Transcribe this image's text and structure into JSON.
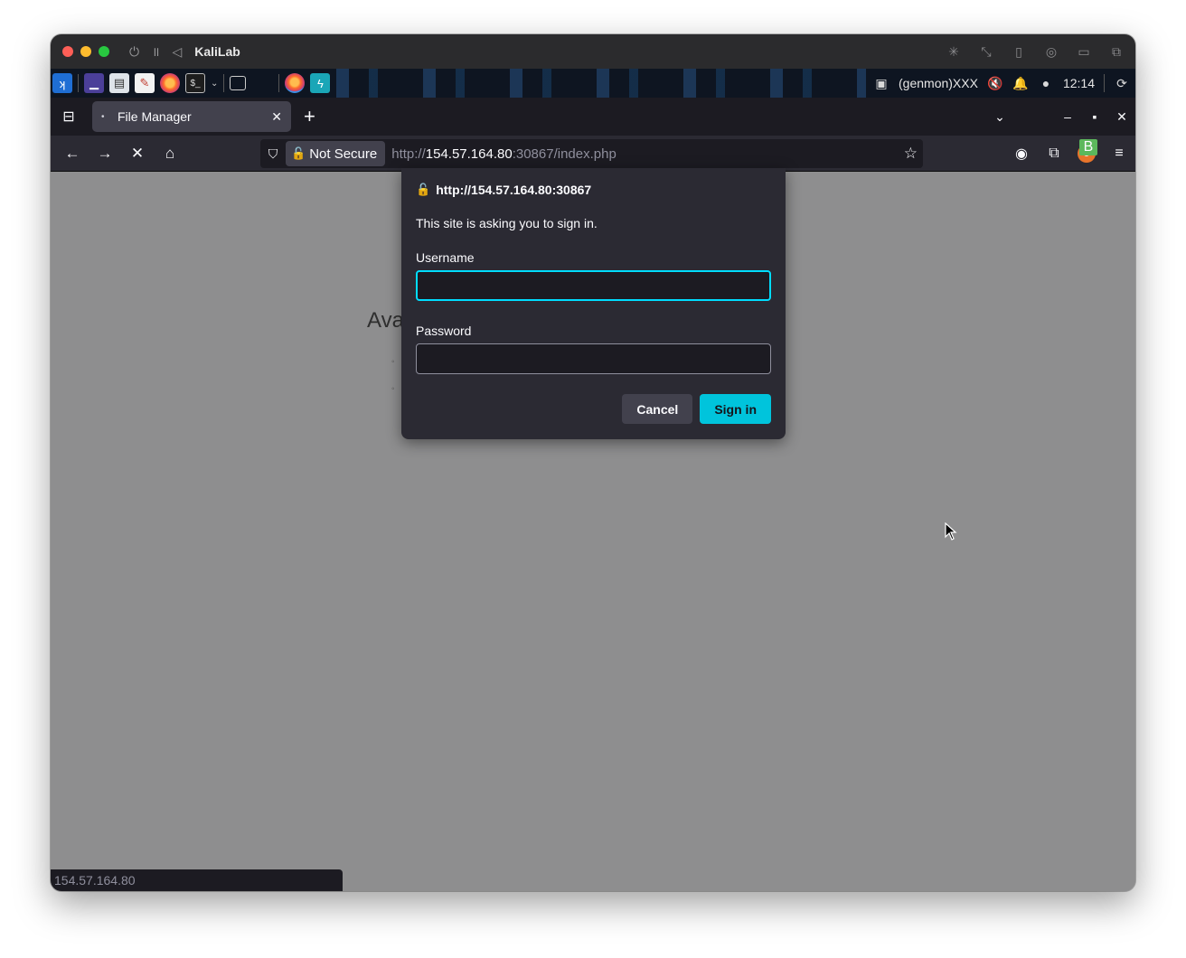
{
  "mac": {
    "title": "KaliLab",
    "controls": [
      "power-icon",
      "pause-icon",
      "back-triangle-icon"
    ],
    "right_icons": [
      "brightness-icon",
      "resize-icon",
      "usb-icon",
      "network-icon",
      "share-folder-icon",
      "windows-icon"
    ]
  },
  "panel": {
    "user_label": "(genmon)XXX",
    "clock": "12:14"
  },
  "tabbar": {
    "tab_title": "File Manager"
  },
  "navbar": {
    "not_secure": "Not Secure",
    "url_scheme": "http://",
    "url_host": "154.57.164.80",
    "url_rest": ":30867/index.php"
  },
  "page": {
    "heading_partial": "Ava",
    "bullets": [
      "◦",
      "◦"
    ]
  },
  "dialog": {
    "title": "http://154.57.164.80:30867",
    "message": "This site is asking you to sign in.",
    "username_label": "Username",
    "username_value": "",
    "password_label": "Password",
    "password_value": "",
    "cancel_label": "Cancel",
    "signin_label": "Sign in"
  },
  "status": {
    "text": "154.57.164.80"
  },
  "colors": {
    "accent": "#00c4dc",
    "focus_ring": "#00ddff",
    "insecure_lock": "#ff8497",
    "mac_close": "#fe5f57",
    "mac_minimize": "#febc2e",
    "mac_zoom": "#28c840"
  }
}
